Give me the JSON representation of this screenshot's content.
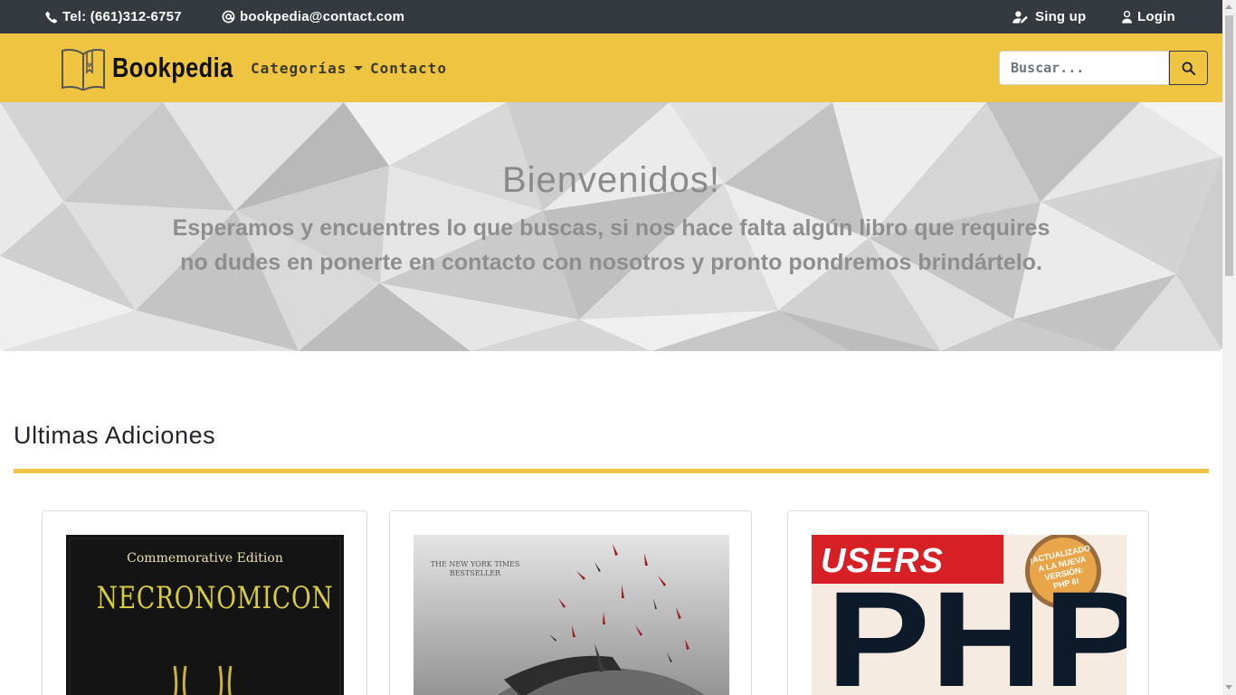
{
  "topbar": {
    "phone": "Tel: (661)312-6757",
    "email": "bookpedia@contact.com",
    "signup": "Sing up",
    "login": "Login"
  },
  "navbar": {
    "brand": "Bookpedia",
    "categories": "Categorías",
    "contact": "Contacto",
    "search_placeholder": "Buscar..."
  },
  "hero": {
    "title": "Bienvenidos!",
    "subtitle_line1": "Esperamos y encuentres lo que buscas, si nos hace falta algún libro que requires",
    "subtitle_line2": "no dudes en ponerte en contacto con nosotros y pronto pondremos brindártelo."
  },
  "section": {
    "title": "Ultimas Adiciones"
  },
  "books": [
    {
      "cover_top": "Commemorative Edition",
      "cover_title": "NECRONOMICON"
    },
    {
      "cover_top": "THE NEW YORK TIMES",
      "cover_top2": "BESTSELLER"
    },
    {
      "cover_top": "USERS",
      "cover_title": "PHP",
      "badge1": "¡ACTUALIZADO",
      "badge2": "A LA NUEVA",
      "badge3": "VERSIÓN:",
      "badge4": "PHP 6!"
    }
  ],
  "colors": {
    "accent": "#efc441",
    "topbar": "#343a40"
  }
}
